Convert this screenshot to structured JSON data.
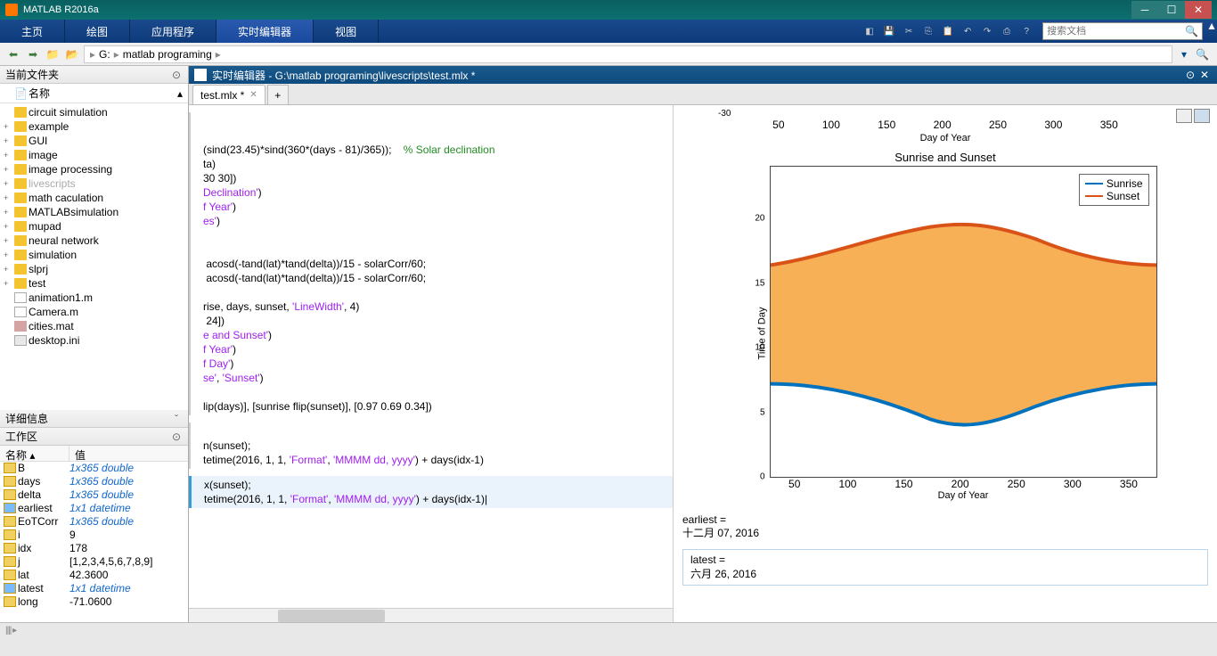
{
  "app_title": "MATLAB R2016a",
  "tabs": {
    "home": "主页",
    "plots": "绘图",
    "apps": "应用程序",
    "editor": "实时编辑器",
    "view": "视图"
  },
  "search_placeholder": "搜索文档",
  "breadcrumb": {
    "drive": "G:",
    "folder": "matlab programing"
  },
  "currentFolder": {
    "title": "当前文件夹",
    "nameCol": "名称"
  },
  "folders": [
    {
      "name": "circuit simulation",
      "type": "folder",
      "exp": ""
    },
    {
      "name": "example",
      "type": "folder",
      "exp": "+"
    },
    {
      "name": "GUI",
      "type": "folder",
      "exp": "+"
    },
    {
      "name": "image",
      "type": "folder",
      "exp": "+"
    },
    {
      "name": "image processing",
      "type": "folder",
      "exp": "+"
    },
    {
      "name": "livescripts",
      "type": "folder",
      "exp": "+",
      "grey": true
    },
    {
      "name": "math caculation",
      "type": "folder",
      "exp": "+"
    },
    {
      "name": "MATLABsimulation",
      "type": "folder",
      "exp": "+"
    },
    {
      "name": "mupad",
      "type": "folder",
      "exp": "+"
    },
    {
      "name": "neural network",
      "type": "folder",
      "exp": "+"
    },
    {
      "name": "simulation",
      "type": "folder",
      "exp": "+"
    },
    {
      "name": "slprj",
      "type": "folder",
      "exp": "+"
    },
    {
      "name": "test",
      "type": "folder",
      "exp": "+"
    },
    {
      "name": "animation1.m",
      "type": "mfile",
      "exp": ""
    },
    {
      "name": "Camera.m",
      "type": "mfile",
      "exp": ""
    },
    {
      "name": "cities.mat",
      "type": "mat",
      "exp": ""
    },
    {
      "name": "desktop.ini",
      "type": "ini",
      "exp": ""
    }
  ],
  "details": {
    "title": "详细信息"
  },
  "workspace": {
    "title": "工作区",
    "nameCol": "名称",
    "valCol": "值"
  },
  "vars": [
    {
      "name": "B",
      "val": "1x365 double",
      "style": "italic"
    },
    {
      "name": "days",
      "val": "1x365 double",
      "style": "italic"
    },
    {
      "name": "delta",
      "val": "1x365 double",
      "style": "italic"
    },
    {
      "name": "earliest",
      "val": "1x1 datetime",
      "style": "italic",
      "ico": "dt"
    },
    {
      "name": "EoTCorr",
      "val": "1x365 double",
      "style": "italic"
    },
    {
      "name": "i",
      "val": "9",
      "style": "plain"
    },
    {
      "name": "idx",
      "val": "178",
      "style": "plain"
    },
    {
      "name": "j",
      "val": "[1,2,3,4,5,6,7,8,9]",
      "style": "plain"
    },
    {
      "name": "lat",
      "val": "42.3600",
      "style": "plain"
    },
    {
      "name": "latest",
      "val": "1x1 datetime",
      "style": "italic",
      "ico": "dt"
    },
    {
      "name": "long",
      "val": "-71.0600",
      "style": "plain"
    }
  ],
  "editor": {
    "header": "实时编辑器 - G:\\matlab programing\\livescripts\\test.mlx *",
    "tab": "test.mlx *"
  },
  "code": {
    "l1a": "(sind(23.45)*sind(360*(days - 81)/365));    ",
    "l1b": "% Solar declination",
    "l2": "ta)",
    "l3": "30 30])",
    "l4": "Declination'",
    ")": ")",
    "l5": "f Year'",
    "l6": "es'",
    "l7": " acosd(-tand(lat)*tand(delta))/15 - solarCorr/60;",
    "l8": " acosd(-tand(lat)*tand(delta))/15 - solarCorr/60;",
    "l9a": "rise, days, sunset, ",
    "l9b": "'LineWidth'",
    "l9c": ", 4)",
    "l10": " 24])",
    "l11": "e and Sunset'",
    "l12": "f Year'",
    "l13": "f Day'",
    "l14a": "se'",
    "l14b": ", ",
    "l14c": "'Sunset'",
    "l15": "lip(days)], [sunrise flip(sunset)], [0.97 0.69 0.34])",
    "l16": "n(sunset);",
    "l17a": "tetime(2016, 1, 1, ",
    "l17b": "'Format'",
    "l17c": ", ",
    "l17d": "'MMMM dd, yyyy'",
    "l17e": ") + days(idx-1)",
    "l18": "x(sunset);",
    "l19a": "tetime(2016, 1, 1, ",
    "l19b": "'Format'",
    "l19c": ", ",
    "l19d": "'MMMM dd, yyyy'",
    "l19e": ") + days(idx-1)"
  },
  "output": {
    "neg30": "-30",
    "xticks": [
      "50",
      "100",
      "150",
      "200",
      "250",
      "300",
      "350"
    ],
    "xlabel": "Day of Year",
    "title": "Sunrise and Sunset",
    "ylabel": "Time of Day",
    "yticks": [
      "0",
      "5",
      "10",
      "15",
      "20"
    ],
    "legend": {
      "a": "Sunrise",
      "b": "Sunset"
    },
    "earliest_label": "earliest =",
    "earliest_val": "    十二月 07, 2016",
    "latest_label": "latest =",
    "latest_val": "    六月 26, 2016"
  },
  "chart_data": {
    "type": "area",
    "title": "Sunrise and Sunset",
    "xlabel": "Day of Year",
    "ylabel": "Time of Day",
    "xlim": [
      0,
      365
    ],
    "ylim": [
      0,
      24
    ],
    "series": [
      {
        "name": "Sunrise",
        "color": "#0072BD",
        "values_sample": [
          7.2,
          6.8,
          6.0,
          5.2,
          4.5,
          4.2,
          4.5,
          5.3,
          6.1,
          6.8,
          7.1,
          7.2
        ]
      },
      {
        "name": "Sunset",
        "color": "#D95319",
        "values_sample": [
          16.4,
          17.2,
          18.0,
          18.8,
          19.3,
          19.4,
          19.2,
          18.4,
          17.4,
          16.6,
          16.2,
          16.4
        ]
      }
    ],
    "fill_color": "#F7B055",
    "x_sample": [
      1,
      30,
      60,
      91,
      121,
      152,
      182,
      213,
      243,
      274,
      305,
      335
    ]
  }
}
